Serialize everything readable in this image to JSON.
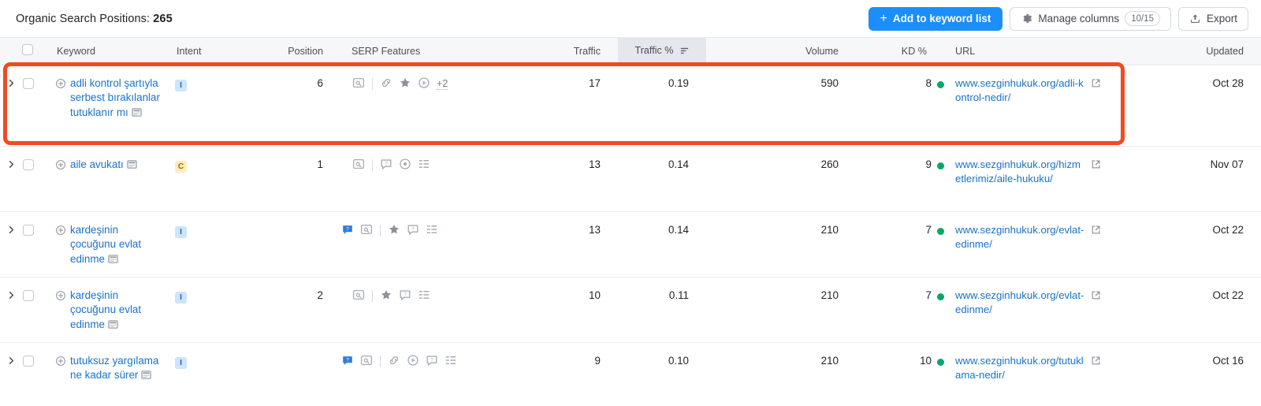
{
  "header": {
    "title_prefix": "Organic Search Positions: ",
    "title_count": "265",
    "add_to_keyword_list": "Add to keyword list",
    "add_plus": "+",
    "manage_columns": "Manage columns",
    "manage_columns_badge": "10/15",
    "export": "Export"
  },
  "columns": {
    "keyword": "Keyword",
    "intent": "Intent",
    "position": "Position",
    "serp_features": "SERP Features",
    "traffic": "Traffic",
    "traffic_pct": "Traffic %",
    "volume": "Volume",
    "kd": "KD %",
    "url": "URL",
    "updated": "Updated"
  },
  "colors": {
    "accent_blue": "#1c8ef9",
    "link_blue": "#1a73c8",
    "highlight_red": "#f04a21",
    "kd_green": "#00a96a",
    "intent_i_bg": "#cde4fb",
    "intent_i_fg": "#1665c1",
    "intent_c_bg": "#fdecbb",
    "intent_c_fg": "#9c6a12",
    "sorted_header_bg": "#e4e7ec"
  },
  "rows": [
    {
      "keyword": "adli kontrol şartıyla serbest bırakılanlar tutuklanır mı",
      "intent": "I",
      "position": "6",
      "serp_leading": null,
      "serp_features": [
        "serp-preview-icon",
        "link-icon",
        "star-icon",
        "video-play-icon"
      ],
      "serp_more": "+2",
      "traffic": "17",
      "traffic_pct": "0.19",
      "volume": "590",
      "kd": "8",
      "url": "www.sezginhukuk.org/adli-kontrol-nedir/",
      "updated": "Oct 28",
      "highlighted": true
    },
    {
      "keyword": "aile avukatı",
      "intent": "C",
      "position": "1",
      "serp_leading": null,
      "serp_features": [
        "serp-preview-icon",
        "faq-icon",
        "local-pack-icon",
        "sitelinks-icon"
      ],
      "serp_more": null,
      "traffic": "13",
      "traffic_pct": "0.14",
      "volume": "260",
      "kd": "9",
      "url": "www.sezginhukuk.org/hizmetlerimiz/aile-hukuku/",
      "updated": "Nov 07",
      "highlighted": false
    },
    {
      "keyword": "kardeşinin çocuğunu evlat edinme",
      "intent": "I",
      "position": "",
      "serp_leading": "featured-snippet-icon",
      "serp_features": [
        "serp-preview-icon",
        "star-icon",
        "faq-icon",
        "sitelinks-icon"
      ],
      "serp_more": null,
      "traffic": "13",
      "traffic_pct": "0.14",
      "volume": "210",
      "kd": "7",
      "url": "www.sezginhukuk.org/evlat-edinme/",
      "updated": "Oct 22",
      "highlighted": false
    },
    {
      "keyword": "kardeşinin çocuğunu evlat edinme",
      "intent": "I",
      "position": "2",
      "serp_leading": null,
      "serp_features": [
        "serp-preview-icon",
        "star-icon",
        "faq-icon",
        "sitelinks-icon"
      ],
      "serp_more": null,
      "traffic": "10",
      "traffic_pct": "0.11",
      "volume": "210",
      "kd": "7",
      "url": "www.sezginhukuk.org/evlat-edinme/",
      "updated": "Oct 22",
      "highlighted": false
    },
    {
      "keyword": "tutuksuz yargılama ne kadar sürer",
      "intent": "I",
      "position": "",
      "serp_leading": "featured-snippet-icon",
      "serp_features": [
        "serp-preview-icon",
        "link-icon",
        "video-play-icon",
        "faq-icon",
        "sitelinks-icon"
      ],
      "serp_more": null,
      "traffic": "9",
      "traffic_pct": "0.10",
      "volume": "210",
      "kd": "10",
      "url": "www.sezginhukuk.org/tutuklama-nedir/",
      "updated": "Oct 16",
      "highlighted": false
    }
  ]
}
